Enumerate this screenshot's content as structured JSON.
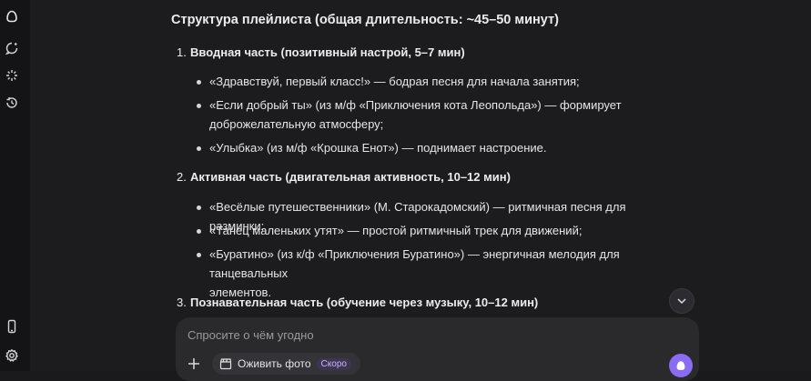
{
  "sidebar": {
    "icons": [
      "alice-logo-icon",
      "new-chat-icon",
      "sparkle-icon",
      "history-icon",
      "phone-icon",
      "settings-icon"
    ]
  },
  "article": {
    "heading": "Структура плейлиста (общая длительность: ~45–50 минут)",
    "sections": [
      {
        "num": "1.",
        "title": "Вводная часть (позитивный настрой, 5–7 мин)",
        "items": [
          {
            "line1": "«Здравствуй, первый класс!» — бодрая песня для начала занятия;",
            "line2": ""
          },
          {
            "line1": "«Если добрый ты» (из м/ф «Приключения кота Леопольда») — формирует",
            "line2": "доброжелательную атмосферу;"
          },
          {
            "line1": "«Улыбка» (из м/ф «Крошка Енот») — поднимает настроение.",
            "line2": ""
          }
        ]
      },
      {
        "num": "2.",
        "title": "Активная часть (двигательная активность, 10–12 мин)",
        "items": [
          {
            "line1": "«Весёлые путешественники» (М. Старокадомский) — ритмичная песня для разминки;",
            "line2": ""
          },
          {
            "line1": "«Танец маленьких утят» — простой ритмичный трек для движений;",
            "line2": ""
          },
          {
            "line1": "«Буратино» (из к/ф «Приключения Буратино») — энергичная мелодия для танцевальных",
            "line2": "элементов."
          }
        ]
      },
      {
        "num": "3.",
        "title": "Познавательная часть (обучение через музыку, 10–12 мин)",
        "items": []
      }
    ]
  },
  "composer": {
    "placeholder": "Спросите о чём угодно",
    "chip_label": "Оживить фото",
    "chip_badge": "Скоро"
  },
  "colors": {
    "background": "#1c1c1e",
    "sidebar": "#141416",
    "accent": "#8a6cf2"
  }
}
